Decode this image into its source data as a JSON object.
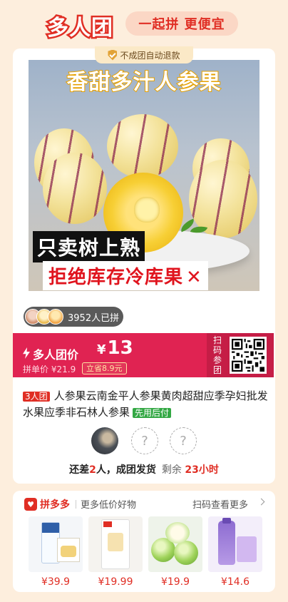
{
  "header": {
    "logo": "多人团",
    "slogan": "一起拼 更便宜"
  },
  "badge": {
    "text": "不成团自动退款",
    "icon": "shield-check-icon"
  },
  "product_image": {
    "title": "香甜多汁人参果",
    "caption_1": "只卖树上熟",
    "caption_2": "拒绝库存冷库果",
    "caption_2_mark": "✕"
  },
  "group": {
    "count_text": "3952人已拼"
  },
  "price": {
    "group_label": "多人团价",
    "currency": "¥",
    "group_price": "13",
    "single_label": "拼单价",
    "single_price": "¥21.9",
    "save_text": "立省8.9元"
  },
  "qr": {
    "label": "扫码参团"
  },
  "product": {
    "tag": "3人团",
    "name": "人参果云南金平人参果黄肉超甜应季孕妇批发水果应季非石林人参果",
    "pay_tag": "先用后付"
  },
  "members": {
    "slot_1": "?",
    "slot_2": "?"
  },
  "status": {
    "prefix": "还差",
    "remaining_count": "2",
    "suffix": "人，成团发货",
    "timer_label": "剩余",
    "timer": "23小时"
  },
  "recommend": {
    "brand": "拼多多",
    "subtitle": "更多低价好物",
    "scan_more": "扫码查看更多",
    "items": [
      {
        "price": "¥39.9"
      },
      {
        "price": "¥19.99"
      },
      {
        "price": "¥19.9"
      },
      {
        "price": "¥14.6"
      }
    ]
  },
  "colors": {
    "brand_red": "#e02e24",
    "banner_pink": "#e02352",
    "background": "#fdeedd",
    "green_tag": "#33a844"
  }
}
